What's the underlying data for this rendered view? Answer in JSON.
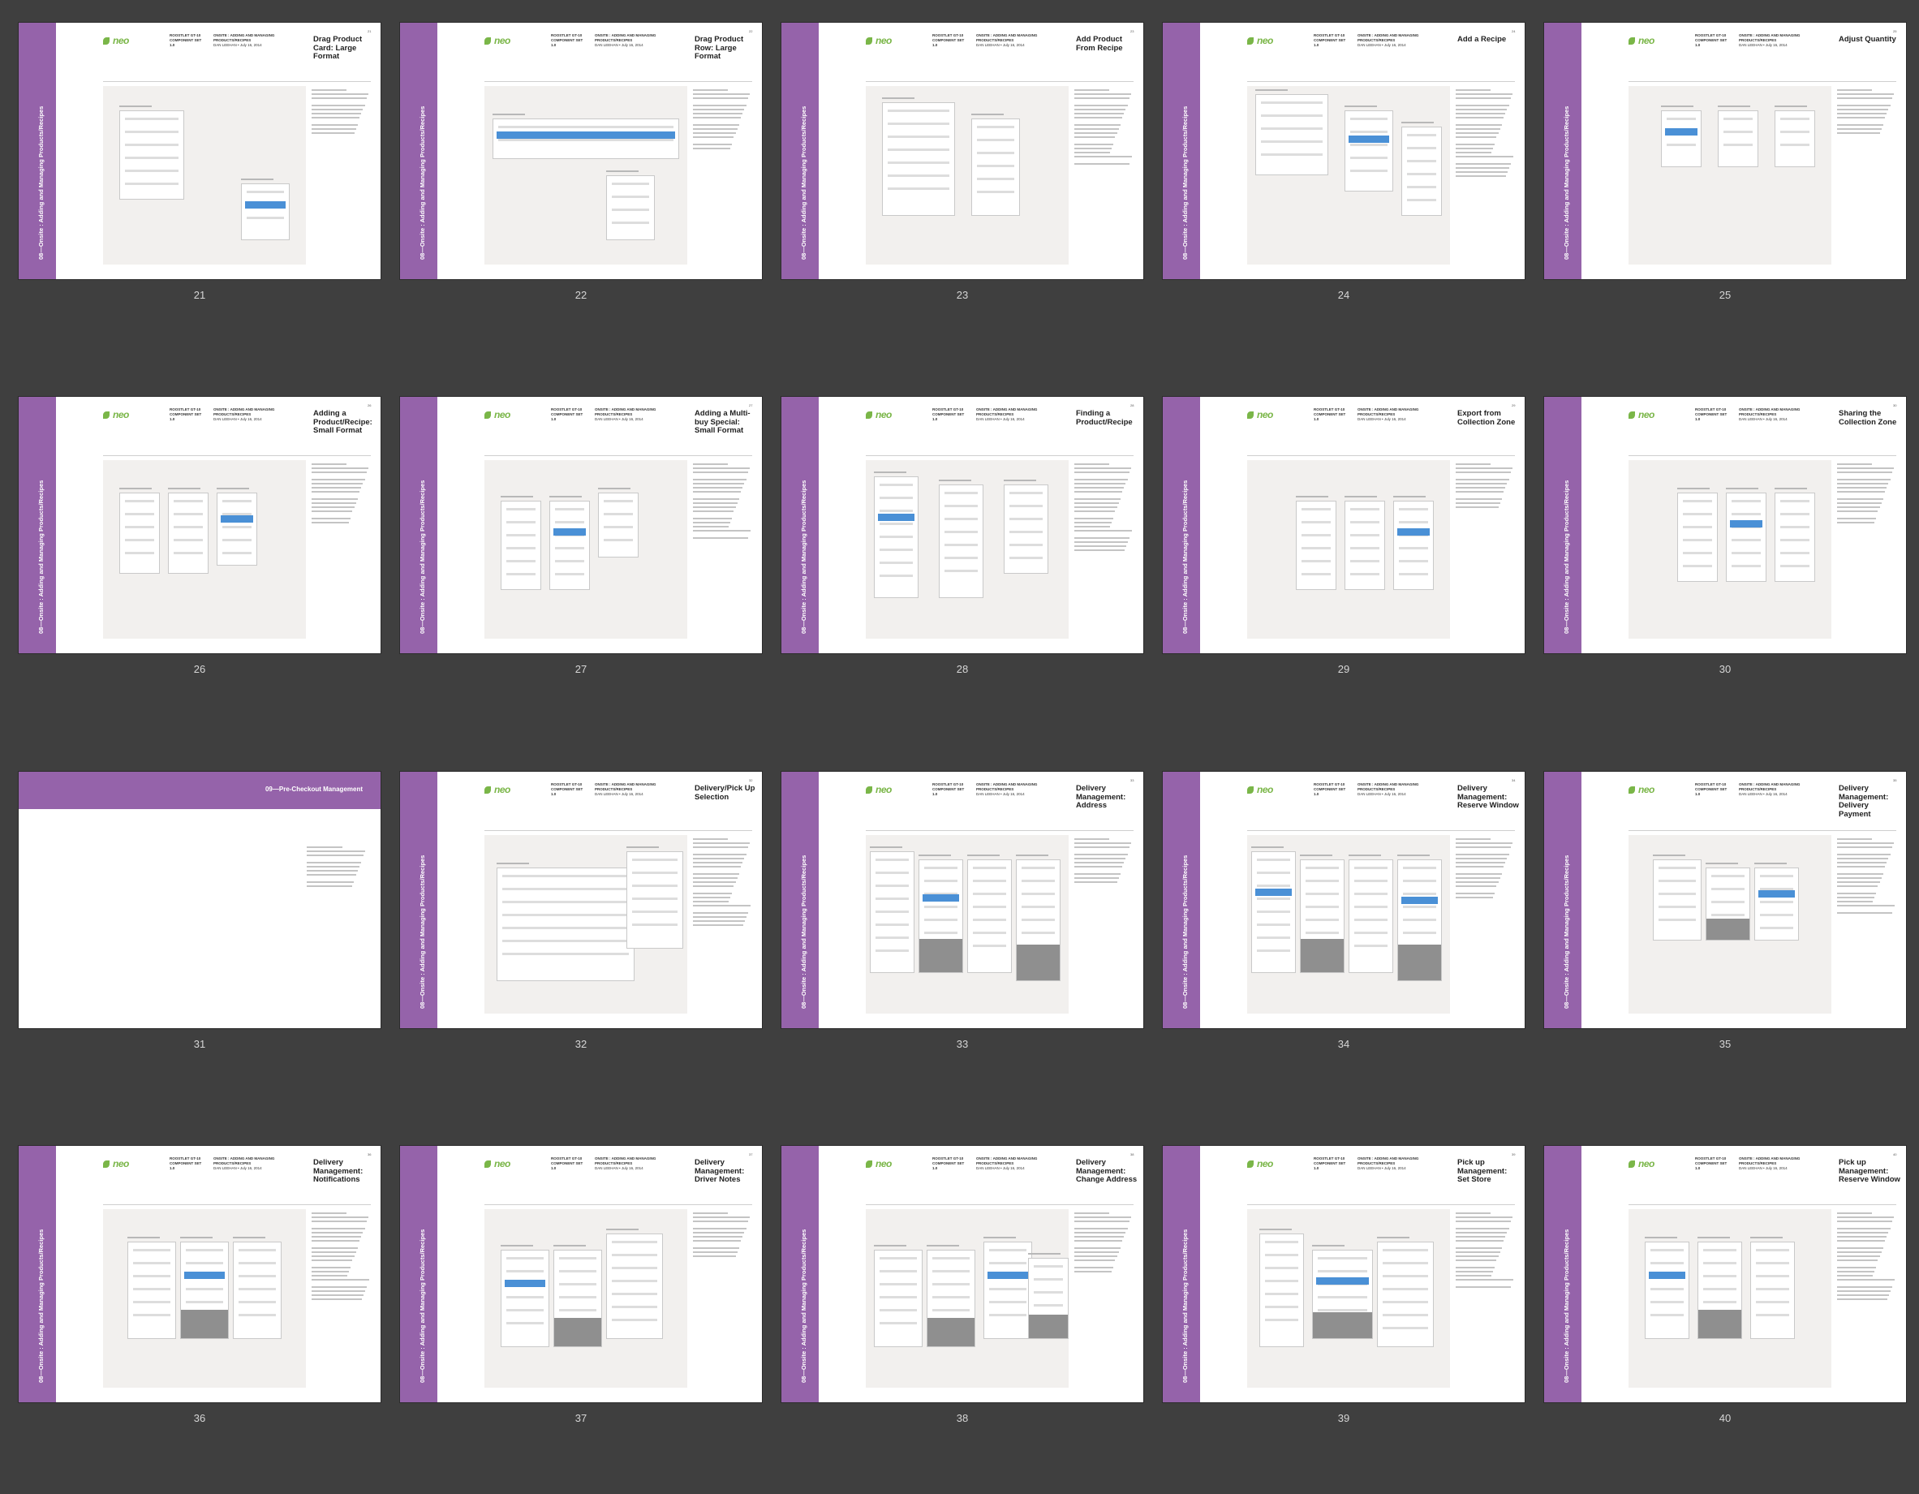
{
  "colors": {
    "background": "#3f3f3f",
    "band": "#9563aa",
    "page": "#ffffff",
    "canvas": "#f2f0ee",
    "accent": "#4a90d6",
    "logo": "#7ab648"
  },
  "common": {
    "band_text": "08—Onsite : Adding and Managing Products/Recipes",
    "logo_icon": "leaf-logo-icon",
    "logo_text": "neo",
    "meta_line1": "ROOSTLET GT-10",
    "meta_line2": "COMPONENT SET 1.0",
    "meta_right1": "ONSITE : ADDING AND MANAGING PRODUCTS/RECIPES",
    "meta_right2": "DAN LEEHAN • July 16, 2014"
  },
  "pages": [
    {
      "num": "21",
      "corner": "21",
      "title": "Drag Product Card: Large Format"
    },
    {
      "num": "22",
      "corner": "22",
      "title": "Drag Product Row: Large Format"
    },
    {
      "num": "23",
      "corner": "23",
      "title": "Add Product From Recipe"
    },
    {
      "num": "24",
      "corner": "24",
      "title": "Add a Recipe"
    },
    {
      "num": "25",
      "corner": "25",
      "title": "Adjust Quantity"
    },
    {
      "num": "26",
      "corner": "26",
      "title": "Adding a Product/Recipe: Small Format"
    },
    {
      "num": "27",
      "corner": "27",
      "title": "Adding a Multi-buy Special: Small Format"
    },
    {
      "num": "28",
      "corner": "28",
      "title": "Finding a Product/Recipe"
    },
    {
      "num": "29",
      "corner": "29",
      "title": "Export from Collection Zone"
    },
    {
      "num": "30",
      "corner": "30",
      "title": "Sharing the Collection Zone"
    },
    {
      "num": "31",
      "divider": true,
      "title": "09—Pre-Checkout Management"
    },
    {
      "num": "32",
      "corner": "32",
      "title": "Delivery/Pick Up Selection"
    },
    {
      "num": "33",
      "corner": "33",
      "title": "Delivery Management: Address"
    },
    {
      "num": "34",
      "corner": "34",
      "title": "Delivery Management: Reserve Window"
    },
    {
      "num": "35",
      "corner": "35",
      "title": "Delivery Management: Delivery Payment"
    },
    {
      "num": "36",
      "corner": "36",
      "title": "Delivery Management: Notifications"
    },
    {
      "num": "37",
      "corner": "37",
      "title": "Delivery Management: Driver Notes"
    },
    {
      "num": "38",
      "corner": "38",
      "title": "Delivery Management: Change Address"
    },
    {
      "num": "39",
      "corner": "39",
      "title": "Pick up Management: Set Store"
    },
    {
      "num": "40",
      "corner": "40",
      "title": "Pick up Management: Reserve Window"
    }
  ]
}
